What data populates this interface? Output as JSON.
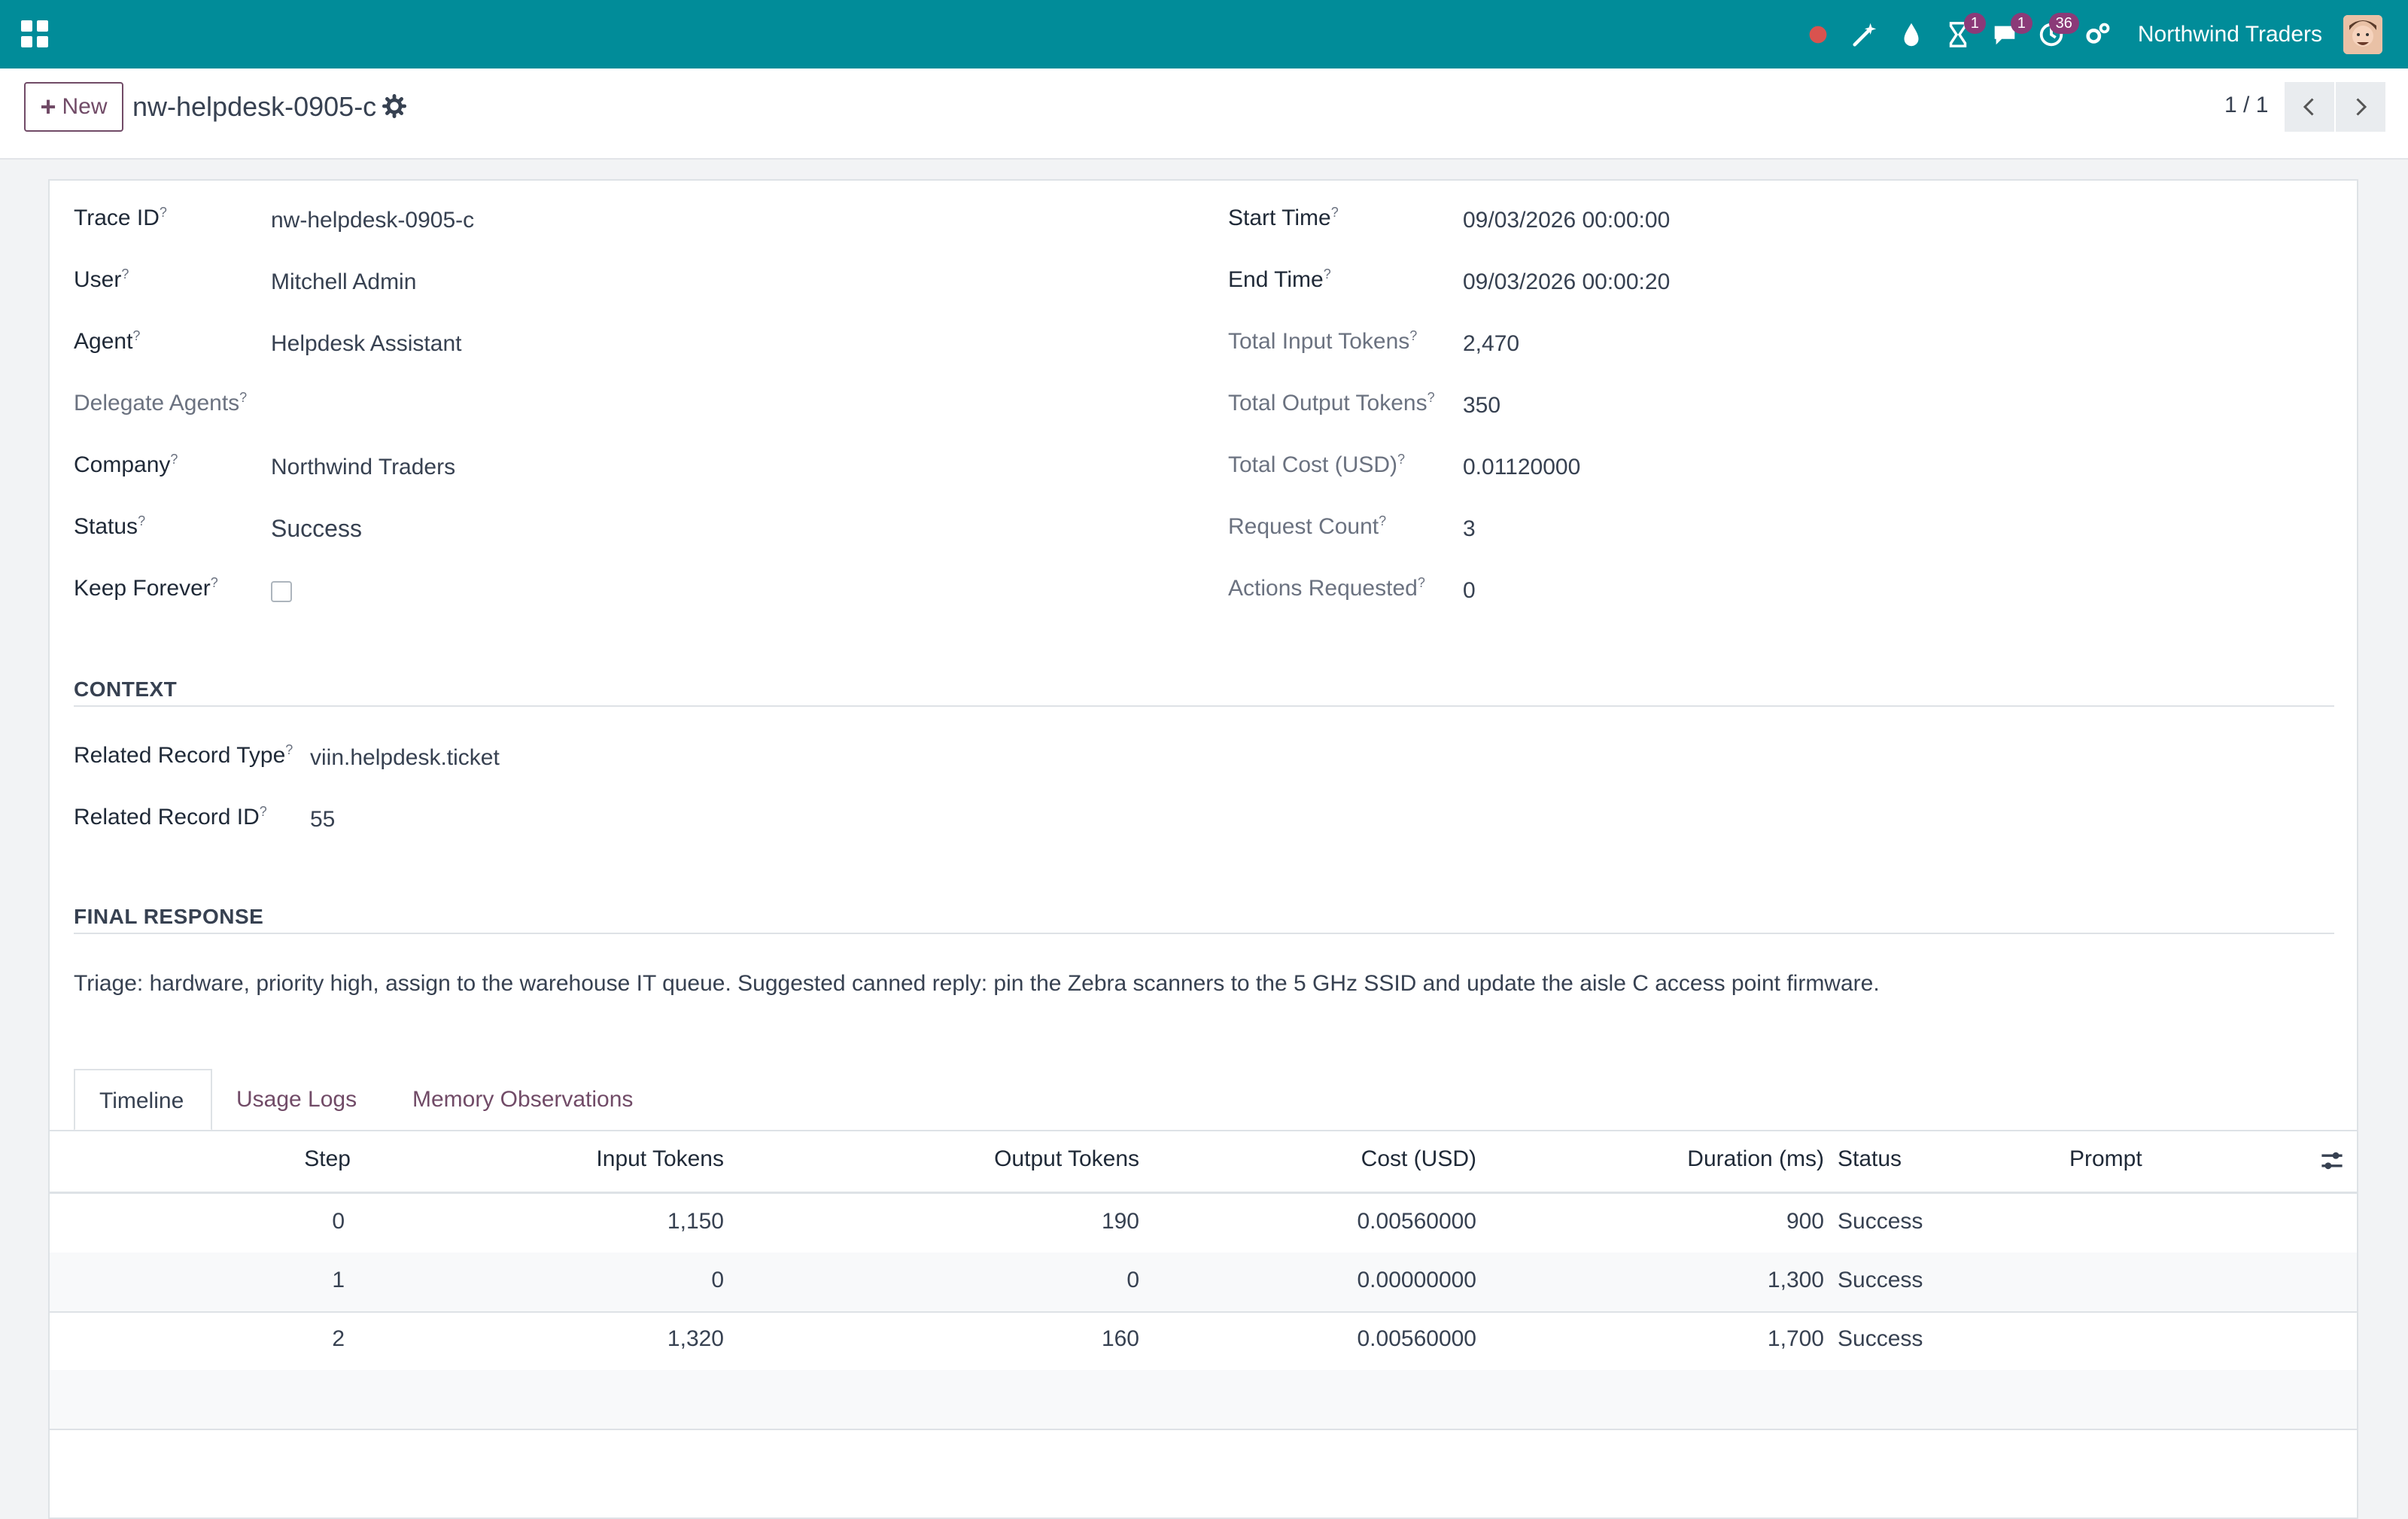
{
  "navbar": {
    "icons": [
      "apps-icon",
      "recording-dot-icon",
      "magic-wand-icon",
      "drop-icon",
      "hourglass-icon",
      "chat-icon",
      "clock-icon",
      "settings-icon"
    ],
    "badges": {
      "activities": "1",
      "messages": "1",
      "clock": "36"
    },
    "company": "Northwind Traders",
    "colors": {
      "navbar": "#018c99",
      "accent": "#714b67",
      "record_dot": "#d9534f"
    }
  },
  "controlbar": {
    "new_label": "New",
    "title": "nw-helpdesk-0905-c",
    "pager": "1 / 1"
  },
  "fields": {
    "trace_id": {
      "label": "Trace ID",
      "value": "nw-helpdesk-0905-c"
    },
    "user": {
      "label": "User",
      "value": "Mitchell Admin"
    },
    "agent": {
      "label": "Agent",
      "value": "Helpdesk Assistant"
    },
    "delegate_agents": {
      "label": "Delegate Agents",
      "value": ""
    },
    "company": {
      "label": "Company",
      "value": "Northwind Traders"
    },
    "status": {
      "label": "Status",
      "value": "Success"
    },
    "keep_forever": {
      "label": "Keep Forever",
      "checked": false
    },
    "start_time": {
      "label": "Start Time",
      "value": "09/03/2026 00:00:00"
    },
    "end_time": {
      "label": "End Time",
      "value": "09/03/2026 00:00:20"
    },
    "total_input_tokens": {
      "label": "Total Input Tokens",
      "value": "2,470"
    },
    "total_output_tokens": {
      "label": "Total Output Tokens",
      "value": "350"
    },
    "total_cost": {
      "label": "Total Cost (USD)",
      "value": "0.01120000"
    },
    "request_count": {
      "label": "Request Count",
      "value": "3"
    },
    "actions_requested": {
      "label": "Actions Requested",
      "value": "0"
    }
  },
  "context": {
    "title": "CONTEXT",
    "related_record_type": {
      "label": "Related Record Type",
      "value": "viin.helpdesk.ticket"
    },
    "related_record_id": {
      "label": "Related Record ID",
      "value": "55"
    }
  },
  "final_response": {
    "title": "FINAL RESPONSE",
    "text": "Triage: hardware, priority high, assign to the warehouse IT queue. Suggested canned reply: pin the Zebra scanners to the 5 GHz SSID and update the aisle C access point firmware."
  },
  "tabs": [
    "Timeline",
    "Usage Logs",
    "Memory Observations"
  ],
  "timeline": {
    "columns": [
      "Step",
      "Input Tokens",
      "Output Tokens",
      "Cost (USD)",
      "Duration (ms)",
      "Status",
      "Prompt"
    ],
    "rows": [
      {
        "step": "0",
        "input": "1,150",
        "output": "190",
        "cost": "0.00560000",
        "duration": "900",
        "status": "Success",
        "prompt": ""
      },
      {
        "step": "1",
        "input": "0",
        "output": "0",
        "cost": "0.00000000",
        "duration": "1,300",
        "status": "Success",
        "prompt": ""
      },
      {
        "step": "2",
        "input": "1,320",
        "output": "160",
        "cost": "0.00560000",
        "duration": "1,700",
        "status": "Success",
        "prompt": ""
      }
    ]
  }
}
